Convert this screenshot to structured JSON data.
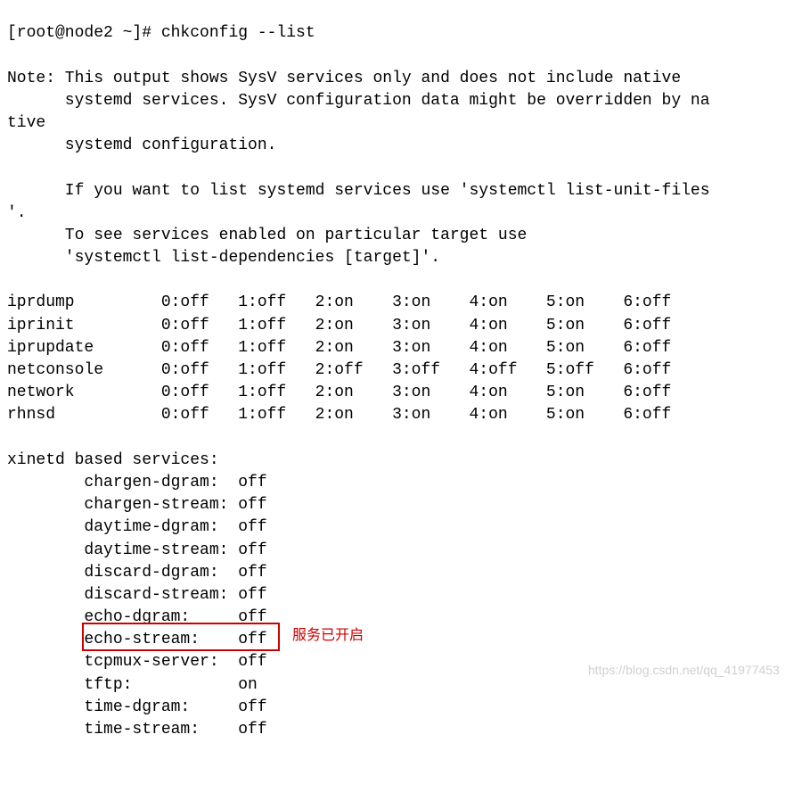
{
  "prompt": "[root@node2 ~]# ",
  "command": "chkconfig --list",
  "note": {
    "l1": "Note: This output shows SysV services only and does not include native",
    "l2": "      systemd services. SysV configuration data might be overridden by na",
    "l3": "tive",
    "l4": "      systemd configuration.",
    "l5": "",
    "l6": "      If you want to list systemd services use 'systemctl list-unit-files",
    "l7": "'.",
    "l8": "      To see services enabled on particular target use",
    "l9": "      'systemctl list-dependencies [target]'."
  },
  "services": {
    "s1": "iprdump         0:off   1:off   2:on    3:on    4:on    5:on    6:off",
    "s2": "iprinit         0:off   1:off   2:on    3:on    4:on    5:on    6:off",
    "s3": "iprupdate       0:off   1:off   2:on    3:on    4:on    5:on    6:off",
    "s4": "netconsole      0:off   1:off   2:off   3:off   4:off   5:off   6:off",
    "s5": "network         0:off   1:off   2:on    3:on    4:on    5:on    6:off",
    "s6": "rhnsd           0:off   1:off   2:on    3:on    4:on    5:on    6:off"
  },
  "xinetd": {
    "header": "xinetd based services:",
    "x1": "        chargen-dgram:  off",
    "x2": "        chargen-stream: off",
    "x3": "        daytime-dgram:  off",
    "x4": "        daytime-stream: off",
    "x5": "        discard-dgram:  off",
    "x6": "        discard-stream: off",
    "x7": "        echo-dgram:     off",
    "x8": "        echo-stream:    off",
    "x9": "        tcpmux-server:  off",
    "x10": "        tftp:           on",
    "x11": "        time-dgram:     off",
    "x12": "        time-stream:    off"
  },
  "annotation_text": "服务已开启",
  "watermark": "https://blog.csdn.net/qq_41977453"
}
